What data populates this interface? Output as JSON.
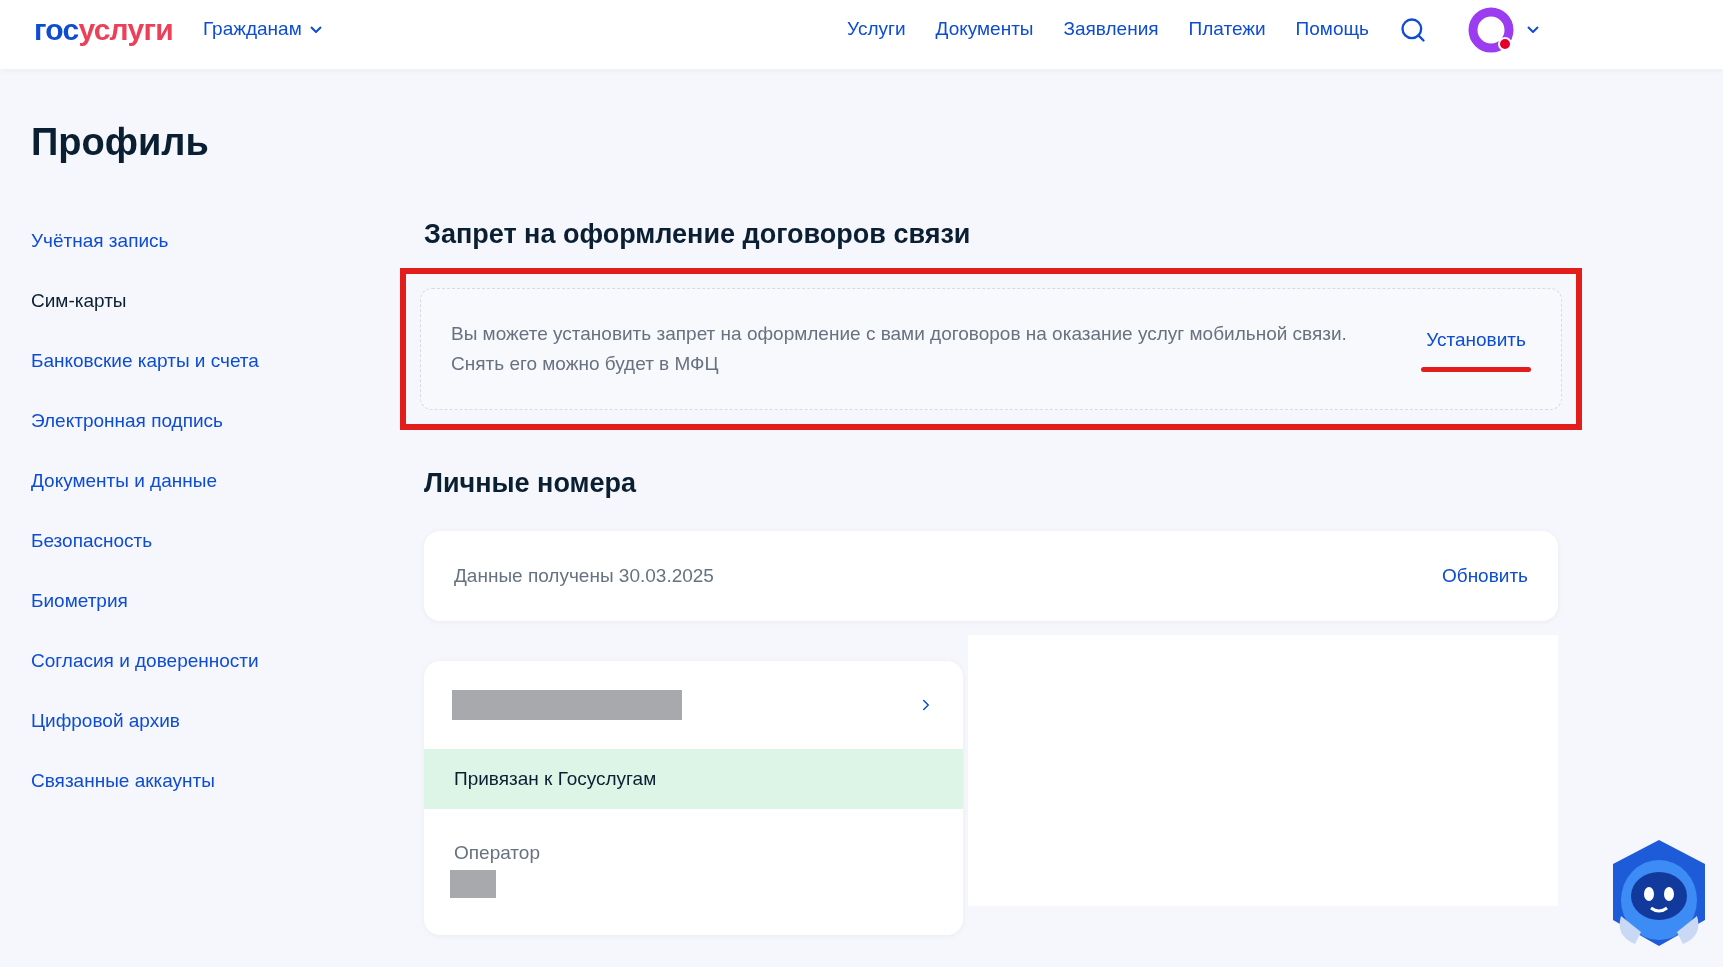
{
  "header": {
    "logo": [
      "гос",
      "услуги"
    ],
    "audience_menu": "Гражданам",
    "nav": [
      "Услуги",
      "Документы",
      "Заявления",
      "Платежи",
      "Помощь"
    ]
  },
  "page_title": "Профиль",
  "sidebar": {
    "items": [
      {
        "label": "Учётная запись",
        "selected": false
      },
      {
        "label": "Сим-карты",
        "selected": true
      },
      {
        "label": "Банковские карты и счета",
        "selected": false
      },
      {
        "label": "Электронная подпись",
        "selected": false
      },
      {
        "label": "Документы и данные",
        "selected": false
      },
      {
        "label": "Безопасность",
        "selected": false
      },
      {
        "label": "Биометрия",
        "selected": false
      },
      {
        "label": "Согласия и доверенности",
        "selected": false
      },
      {
        "label": "Цифровой архив",
        "selected": false
      },
      {
        "label": "Связанные аккаунты",
        "selected": false
      }
    ]
  },
  "ban_section": {
    "title": "Запрет на оформление договоров связи",
    "text": "Вы можете установить запрет на оформление с вами договоров на оказание услуг мобильной связи. Снять его можно будет в МФЦ",
    "action": "Установить",
    "highlighted": true
  },
  "numbers_section": {
    "title": "Личные номера",
    "status": "Данные получены 30.03.2025",
    "refresh": "Обновить",
    "sim_card": {
      "linked": true,
      "linked_label": "Привязан к Госуслугам",
      "operator_label": "Оператор"
    }
  }
}
